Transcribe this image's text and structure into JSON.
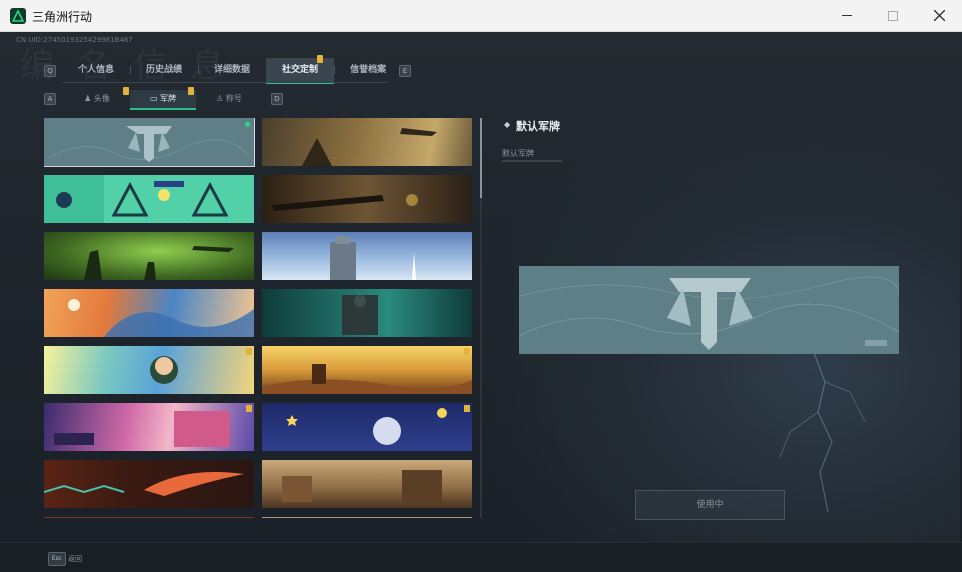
{
  "window": {
    "title": "三角洲行动",
    "minimize": "—",
    "maximize": "☐",
    "close": "✕"
  },
  "header": {
    "uid": "CN UID:2745019325429981B487",
    "ghost_title": "编 名 信 息"
  },
  "keyhints": {
    "prev_tab": "Q",
    "next_tab": "E",
    "prev_sub": "A",
    "next_sub": "D"
  },
  "tabs": [
    "个人信息",
    "历史战绩",
    "详细数据",
    "社交定制",
    "信誉档案"
  ],
  "subtabs": [
    "头像",
    "军牌",
    "称号"
  ],
  "detail": {
    "title": "默认军牌",
    "subtitle": "默认军牌"
  },
  "buttons": {
    "use": "使用中"
  },
  "footer": {
    "esc_key": "Esc",
    "esc_label": "返回"
  },
  "colors": {
    "accent": "#27c28a",
    "badge": "#e2b33a",
    "preview_bg": "#5f7f86"
  }
}
